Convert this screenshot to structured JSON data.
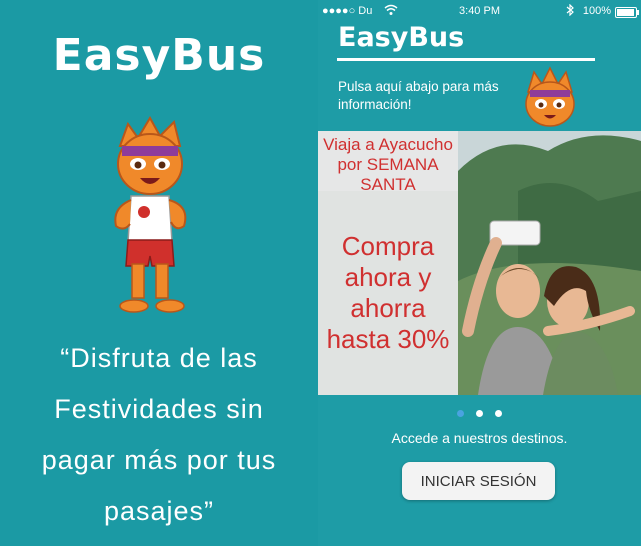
{
  "left": {
    "logo": "EasyBus",
    "quote": "“Disfruta de las Festividades sin pagar más por tus pasajes”"
  },
  "phone": {
    "status": {
      "carrier": "●●●●○ Du",
      "time": "3:40 PM",
      "battery": "100%"
    },
    "title": "EasyBus",
    "info": "Pulsa aquí abajo para más información!",
    "promo": {
      "top": "Viaja a Ayacucho por SEMANA SANTA",
      "main": "Compra ahora y ahorra hasta 30%"
    },
    "carousel": {
      "pages": 3,
      "active": 0
    },
    "access_text": "Accede a nuestros destinos.",
    "login_label": "INICIAR SESIÓN"
  },
  "colors": {
    "background": "#1c9aa5",
    "promo_text": "#d03030",
    "active_dot": "#4aa3e0"
  }
}
